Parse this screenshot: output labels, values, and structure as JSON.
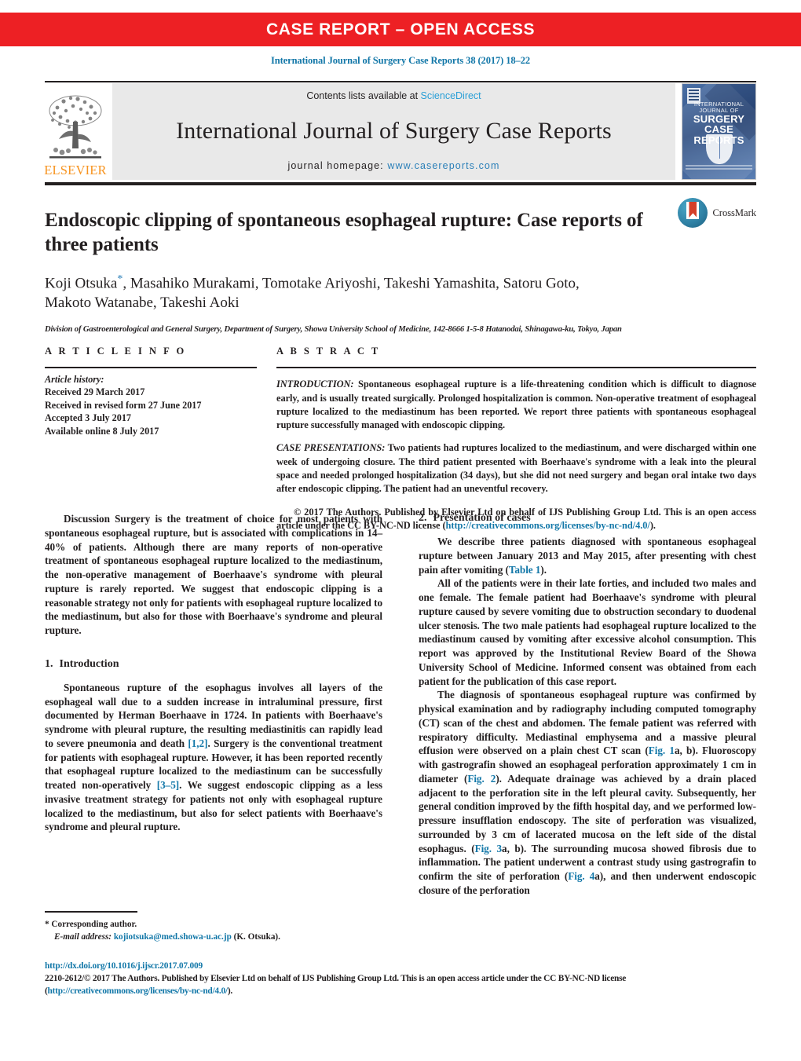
{
  "banner": {
    "text": "CASE REPORT – OPEN ACCESS"
  },
  "running_head": "International Journal of Surgery Case Reports 38 (2017) 18–22",
  "masthead": {
    "publisher_name": "ELSEVIER",
    "contents_prefix": "Contents lists available at ",
    "contents_link": "ScienceDirect",
    "journal_title": "International Journal of Surgery Case Reports",
    "homepage_prefix": "journal homepage: ",
    "homepage_url": "www.casereports.com",
    "cover": {
      "line1": "INTERNATIONAL",
      "line2": "JOURNAL OF",
      "line3": "SURGERY",
      "line4": "CASE",
      "line5": "REPORTS"
    }
  },
  "article": {
    "title": "Endoscopic clipping of spontaneous esophageal rupture: Case reports of three patients",
    "authors_line1": "Koji Otsuka",
    "authors_star": "*",
    "authors_line1_rest": ", Masahiko Murakami, Tomotake Ariyoshi, Takeshi Yamashita, Satoru Goto,",
    "authors_line2": "Makoto Watanabe, Takeshi Aoki",
    "affiliation": "Division of Gastroenterological and General Surgery, Department of Surgery, Showa University School of Medicine, 142-8666 1-5-8 Hatanodai, Shinagawa-ku, Tokyo, Japan",
    "crossmark_label": "CrossMark"
  },
  "article_info": {
    "heading": "A R T I C L E   I N F O",
    "history_label": "Article history:",
    "history": [
      "Received 29 March 2017",
      "Received in revised form 27 June 2017",
      "Accepted 3 July 2017",
      "Available online 8 July 2017"
    ]
  },
  "abstract": {
    "heading": "A B S T R A C T",
    "intro_label": "INTRODUCTION:",
    "intro_text": " Spontaneous esophageal rupture is a life-threatening condition which is difficult to diagnose early, and is usually treated surgically. Prolonged hospitalization is common. Non-operative treatment of esophageal rupture localized to the mediastinum has been reported. We report three patients with spontaneous esophageal rupture successfully managed with endoscopic clipping.",
    "cases_label": "CASE PRESENTATIONS:",
    "cases_text": " Two patients had ruptures localized to the mediastinum, and were discharged within one week of undergoing closure. The third patient presented with Boerhaave's syndrome with a leak into the pleural space and needed prolonged hospitalization (34 days), but she did not need surgery and began oral intake two days after endoscopic clipping. The patient had an uneventful recovery.",
    "copyright_text": "© 2017 The Authors. Published by Elsevier Ltd on behalf of IJS Publishing Group Ltd. This is an open access article under the CC BY-NC-ND license (",
    "copyright_link": "http://creativecommons.org/licenses/by-nc-nd/4.0/",
    "copyright_tail": ")."
  },
  "body": {
    "left": {
      "discussion_para": "Discussion Surgery is the treatment of choice for most patients with spontaneous esophageal rupture, but is associated with complications in 14–40% of patients. Although there are many reports of non-operative treatment of spontaneous esophageal rupture localized to the mediastinum, the non-operative management of Boerhaave's syndrome with pleural rupture is rarely reported. We suggest that endoscopic clipping is a reasonable strategy not only for patients with esophageal rupture localized to the mediastinum, but also for those with Boerhaave's syndrome and pleural rupture.",
      "section_number": "1.",
      "section_title": "Introduction",
      "intro_p1_a": "Spontaneous rupture of the esophagus involves all layers of the esophageal wall due to a sudden increase in intraluminal pressure, first documented by Herman Boerhaave in 1724. In patients with Boerhaave's syndrome with pleural rupture, the resulting mediastinitis can rapidly lead to severe pneumonia and death ",
      "ref_1_2": "[1,2]",
      "intro_p1_b": ". Surgery is the conventional treatment for patients with esophageal rupture. However, it has been reported recently that esophageal rupture localized to the mediastinum can be successfully treated non-operatively ",
      "ref_3_5": "[3–5]",
      "intro_p1_c": ". We suggest endoscopic clipping as a less invasive treatment strategy for patients not only with esophageal rupture localized to the mediastinum, but also for select patients with Boerhaave's syndrome and pleural rupture."
    },
    "right": {
      "section_number": "2.",
      "section_title": "Presentation of cases",
      "p1_a": "We describe three patients diagnosed with spontaneous esophageal rupture between January 2013 and May 2015, after presenting with chest pain after vomiting (",
      "p1_link": "Table 1",
      "p1_b": ").",
      "p2": "All of the patients were in their late forties, and included two males and one female. The female patient had Boerhaave's syndrome with pleural rupture caused by severe vomiting due to obstruction secondary to duodenal ulcer stenosis. The two male patients had esophageal rupture localized to the mediastinum caused by vomiting after excessive alcohol consumption. This report was approved by the Institutional Review Board of the Showa University School of Medicine. Informed consent was obtained from each patient for the publication of this case report.",
      "p3_a": "The diagnosis of spontaneous esophageal rupture was confirmed by physical examination and by radiography including computed tomography (CT) scan of the chest and abdomen. The female patient was referred with respiratory difficulty. Mediastinal emphysema and a massive pleural effusion were observed on a plain chest CT scan (",
      "p3_link1": "Fig. 1",
      "p3_b": "a, b). Fluoroscopy with gastrografin showed an esophageal perforation approximately 1 cm in diameter (",
      "p3_link2": "Fig. 2",
      "p3_c": "). Adequate drainage was achieved by a drain placed adjacent to the perforation site in the left pleural cavity. Subsequently, her general condition improved by the fifth hospital day, and we performed low-pressure insufflation endoscopy. The site of perforation was visualized, surrounded by 3 cm of lacerated mucosa on the left side of the distal esophagus. (",
      "p3_link3": "Fig. 3",
      "p3_d": "a, b). The surrounding mucosa showed fibrosis due to inflammation. The patient underwent a contrast study using gastrografin to confirm the site of perforation (",
      "p3_link4": "Fig. 4",
      "p3_e": "a), and then underwent endoscopic closure of the perforation"
    }
  },
  "footnote": {
    "star": "*",
    "corresponding": "Corresponding author.",
    "email_label": "E-mail address:",
    "email": "kojiotsuka@med.showa-u.ac.jp",
    "email_owner": "(K. Otsuka)."
  },
  "bottom": {
    "doi": "http://dx.doi.org/10.1016/j.ijscr.2017.07.009",
    "issn_copy": "2210-2612/© 2017 The Authors. Published by Elsevier Ltd on behalf of IJS Publishing Group Ltd. This is an open access article under the CC BY-NC-ND license (",
    "license_link_a": "http://",
    "license_link_b": "creativecommons.org/licenses/by-nc-nd/4.0/",
    "tail": ")."
  },
  "colors": {
    "banner_red": "#ed2024",
    "link_blue": "#1277a8",
    "elsevier_orange": "#f79420",
    "masthead_grey": "#e9e9e9"
  }
}
